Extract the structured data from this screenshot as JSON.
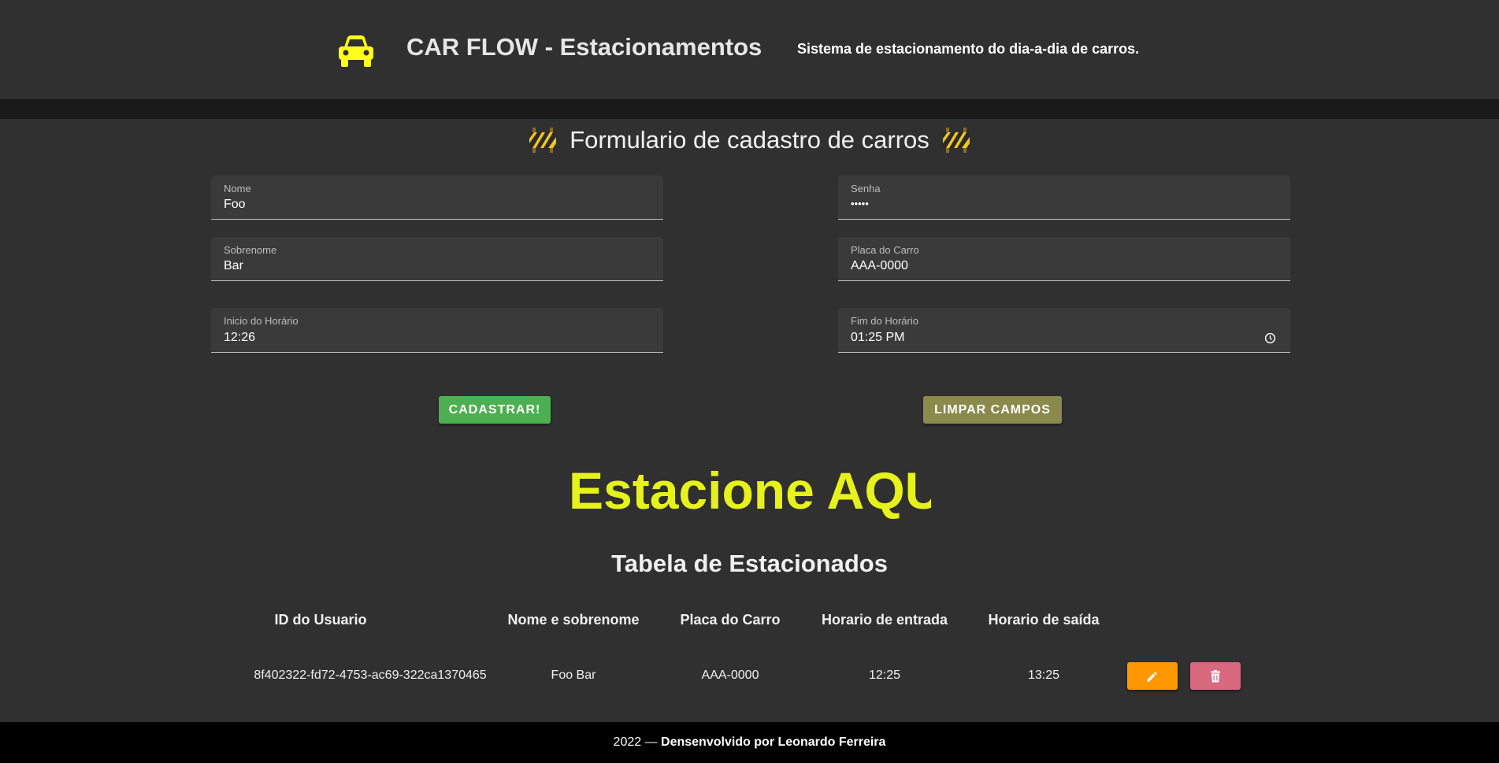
{
  "header": {
    "title": "CAR FLOW - Estacionamentos",
    "subtitle": "Sistema de estacionamento do dia-a-dia de carros.",
    "logo_icon": "car-icon",
    "logo_color": "#ffff1a"
  },
  "form": {
    "title": "Formulario de cadastro de carros",
    "title_icon": "construction-barrier-icon",
    "fields": {
      "nome": {
        "label": "Nome",
        "value": "Foo"
      },
      "senha": {
        "label": "Senha",
        "value": "•••••"
      },
      "sobrenome": {
        "label": "Sobrenome",
        "value": "Bar"
      },
      "placa": {
        "label": "Placa do Carro",
        "value": "AAA-0000"
      },
      "inicio": {
        "label": "Inicio do Horário",
        "value": "12:26"
      },
      "fim": {
        "label": "Fim do Horário",
        "value": "01:25 PM"
      }
    },
    "buttons": {
      "submit": "CADASTRAR!",
      "clear": "LIMPAR CAMPOS"
    },
    "colors": {
      "submit": "#4caf50",
      "clear": "#8a8a4c"
    }
  },
  "banner": {
    "text": "Estacione AQUI",
    "color": "#e6f21a"
  },
  "table": {
    "title": "Tabela de Estacionados",
    "headers": [
      "ID do Usuario",
      "Nome e sobrenome",
      "Placa do Carro",
      "Horario de entrada",
      "Horario de saída"
    ],
    "rows": [
      [
        "8f402322-fd72-4753-ac69-322ca1370465",
        "Foo Bar",
        "AAA-0000",
        "12:25",
        "13:25"
      ]
    ],
    "row_actions": {
      "edit_icon": "pencil-icon",
      "delete_icon": "trash-icon",
      "edit_color": "#ff9800",
      "delete_color": "#d9697e"
    }
  },
  "footer": {
    "year": "2022 — ",
    "credit": "Densenvolvido por Leonardo Ferreira"
  }
}
